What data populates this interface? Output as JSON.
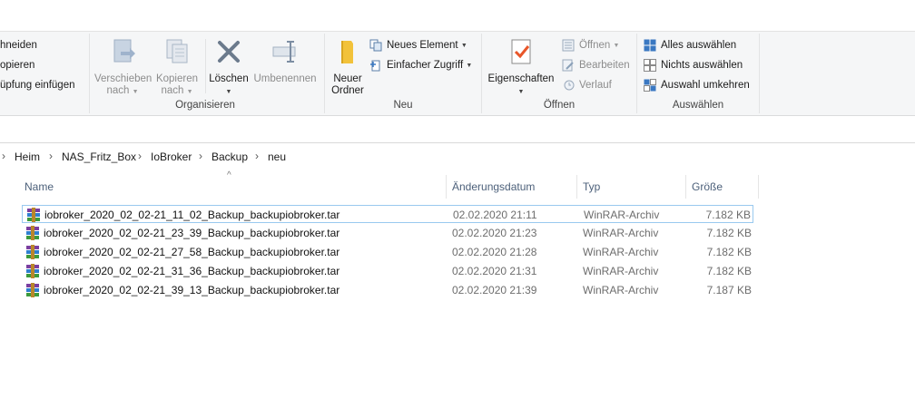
{
  "ribbon": {
    "clipboard_partial": {
      "cut": "hneiden",
      "copy_path": "opieren",
      "paste_shortcut": "üpfung einfügen"
    },
    "organize": {
      "label": "Organisieren",
      "move_to": [
        "Verschieben",
        "nach"
      ],
      "copy_to": [
        "Kopieren",
        "nach"
      ],
      "delete": "Löschen",
      "rename": "Umbenennen"
    },
    "new": {
      "label": "Neu",
      "new_folder": [
        "Neuer",
        "Ordner"
      ],
      "new_item": "Neues Element",
      "easy_access": "Einfacher Zugriff"
    },
    "open": {
      "label": "Öffnen",
      "properties": "Eigenschaften",
      "open": "Öffnen",
      "edit": "Bearbeiten",
      "history": "Verlauf"
    },
    "select": {
      "label": "Auswählen",
      "select_all": "Alles auswählen",
      "select_none": "Nichts auswählen",
      "invert": "Auswahl umkehren"
    }
  },
  "breadcrumb": [
    "Heim",
    "NAS_Fritz_Box",
    "IoBroker",
    "Backup",
    "neu"
  ],
  "columns": {
    "name": "Name",
    "date": "Änderungsdatum",
    "type": "Typ",
    "size": "Größe"
  },
  "files": [
    {
      "name": "iobroker_2020_02_02-21_11_02_Backup_backupiobroker.tar",
      "date": "02.02.2020 21:11",
      "type": "WinRAR-Archiv",
      "size": "7.182 KB"
    },
    {
      "name": "iobroker_2020_02_02-21_23_39_Backup_backupiobroker.tar",
      "date": "02.02.2020 21:23",
      "type": "WinRAR-Archiv",
      "size": "7.182 KB"
    },
    {
      "name": "iobroker_2020_02_02-21_27_58_Backup_backupiobroker.tar",
      "date": "02.02.2020 21:28",
      "type": "WinRAR-Archiv",
      "size": "7.182 KB"
    },
    {
      "name": "iobroker_2020_02_02-21_31_36_Backup_backupiobroker.tar",
      "date": "02.02.2020 21:31",
      "type": "WinRAR-Archiv",
      "size": "7.182 KB"
    },
    {
      "name": "iobroker_2020_02_02-21_39_13_Backup_backupiobroker.tar",
      "date": "02.02.2020 21:39",
      "type": "WinRAR-Archiv",
      "size": "7.187 KB"
    }
  ],
  "colors": {
    "ribbon_bg": "#f5f6f7",
    "header_text": "#4c607a",
    "selection_border": "#99c9ef"
  }
}
